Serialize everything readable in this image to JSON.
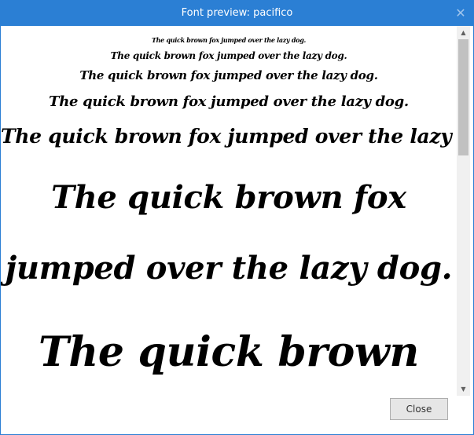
{
  "window": {
    "title": "Font preview: pacifico",
    "close_glyph": "✕",
    "accent_color": "#2b7fd4"
  },
  "preview": {
    "lines": [
      "The quick brown fox jumped over the lazy dog.",
      "The quick brown fox jumped over the lazy dog.",
      "The quick brown fox jumped over the lazy dog.",
      "The quick brown fox jumped over the lazy dog.",
      "The quick brown fox jumped over the lazy dog.",
      "The quick brown fox",
      "jumped over the lazy dog.",
      "The quick brown"
    ]
  },
  "scrollbar": {
    "up_glyph": "▲",
    "down_glyph": "▼"
  },
  "footer": {
    "close_label": "Close"
  }
}
